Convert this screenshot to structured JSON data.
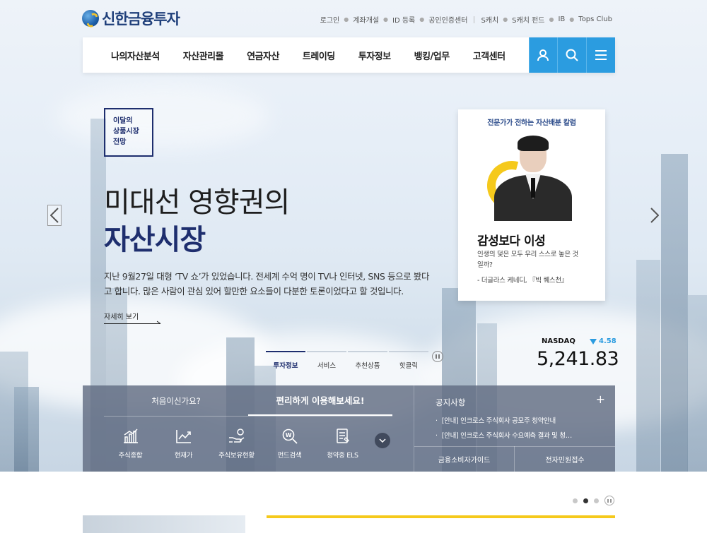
{
  "header": {
    "brand": "신한금융투자",
    "util_links": [
      "로그인",
      "계좌개설",
      "ID 등록",
      "공인인증센터"
    ],
    "util_links2": [
      "S캐치",
      "S캐치 펀드",
      "IB",
      "Tops Club"
    ],
    "menu": [
      "나의자산분석",
      "자산관리몰",
      "연금자산",
      "트레이딩",
      "투자정보",
      "뱅킹/업무",
      "고객센터"
    ]
  },
  "hero": {
    "badge_lines": [
      "이달의",
      "상품시장",
      "전망"
    ],
    "title_line1": "미대선 영향권의",
    "title_line2": "자산시장",
    "desc": "지난 9월27일 대형 ‘TV 쇼’가 있었습니다. 전세계 수억 명이 TV나 인터넷, SNS 등으로 봤다고 합니다. 많은 사람이 관심 있어 할만한 요소들이 다분한 토론이었다고 할 것입니다.",
    "more": "자세히 보기",
    "tabs": [
      "투자정보",
      "서비스",
      "추천상품",
      "핫클릭"
    ]
  },
  "column": {
    "caption": "전문가가 전하는 자산배분 칼럼",
    "name": "감성보다 이성",
    "quote": "인생의 덫은 모두 우리 스스로 놓은 것일까?",
    "source": "- 더글라스 케네디, 『빅 퀘스천』"
  },
  "index": {
    "name": "NASDAQ",
    "change": "4.58",
    "value": "5,241.83"
  },
  "quick": {
    "tab_a": "처음이신가요?",
    "tab_b": "편리하게 이용해보세요!",
    "items": [
      "주식종합",
      "현재가",
      "주식보유현황",
      "펀드검색",
      "청약중 ELS"
    ]
  },
  "notice": {
    "title": "공지사항",
    "items": [
      "[안내] 인크로스 주식회사 공모주 청약안내",
      "[안내] 인크로스 주식회사 수요예측 결과 및 청…"
    ],
    "btn_left": "금융소비자가이드",
    "btn_right": "전자민원접수"
  },
  "colors": {
    "accent": "#2b9ce0",
    "navy": "#1e2e6e",
    "yellow": "#f5c91c"
  }
}
